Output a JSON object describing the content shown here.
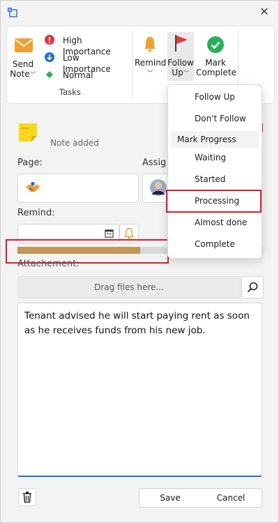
{
  "colors": {
    "accent": "#1f6fd1",
    "progress": "#c4955a",
    "highlight": "#d41f2d",
    "flag": "#e23a3a",
    "check": "#2bae5b",
    "bell": "#f0a030"
  },
  "ribbon": {
    "send_note_line1": "Send",
    "send_note_line2": "Note",
    "high_importance": "High Importance",
    "low_importance": "Low Importance",
    "normal": "Normal",
    "tasks_group": "Tasks",
    "remind": "Remind",
    "follow_up_line1": "Follow",
    "follow_up_line2": "Up",
    "mark_complete_line1": "Mark",
    "mark_complete_line2": "Complete"
  },
  "note": {
    "status": "Note added"
  },
  "fields": {
    "page_label": "Page:",
    "assigned_label": "Assig",
    "remind_label": "Remind:",
    "attachment_label": "Attachement:",
    "drag_placeholder": "Drag files here..."
  },
  "progress": {
    "value": 0.5
  },
  "body_text": "Tenant advised he will start paying rent as soon as he receives funds from his new job.",
  "menu": {
    "follow_up": "Follow Up",
    "dont_follow": "Don't Follow",
    "mark_progress": "Mark Progress",
    "waiting": "Waiting",
    "started": "Started",
    "processing": "Processing",
    "almost_done": "Almost done",
    "complete": "Complete"
  },
  "footer": {
    "save": "Save",
    "cancel": "Cancel"
  }
}
